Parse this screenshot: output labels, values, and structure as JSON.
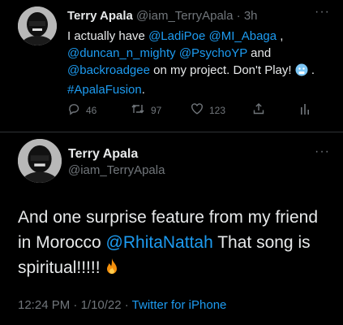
{
  "tweet1": {
    "name": "Terry Apala",
    "handle": "@iam_TerryApala",
    "sep": " · ",
    "time": "3h",
    "more": "···",
    "text": {
      "p1": "I actually have ",
      "m1": "@LadiPoe",
      "p2": "  ",
      "m2": "@MI_Abaga",
      "p3": " , ",
      "m3": "@duncan_n_mighty",
      "p4": " ",
      "m4": "@PsychoYP",
      "p5": " and ",
      "m5": "@backroadgee",
      "p6": " on my project. Don't Play! ",
      "p7": " . ",
      "hashtag": "#ApalaFusion",
      "p8": ".",
      "emoji_icon": "cold-face-emoji"
    },
    "actions": {
      "replies": "46",
      "retweets": "97",
      "likes": "123"
    }
  },
  "tweet2": {
    "name": "Terry Apala",
    "handle": "@iam_TerryApala",
    "more": "···",
    "text": {
      "p1": "And one surprise feature from my friend in Morocco ",
      "mention": "@RhitaNattah",
      "p2": " That song is spiritual!!!!! ",
      "emoji_icon": "fire-emoji"
    },
    "meta": {
      "time": "12:24 PM",
      "sep1": " · ",
      "date": "1/10/22",
      "sep2": " · ",
      "source": "Twitter for iPhone"
    }
  },
  "colors": {
    "background": "#000000",
    "text": "#e7e9ea",
    "muted": "#71767b",
    "link": "#1d9bf0",
    "divider": "#2f3336"
  }
}
